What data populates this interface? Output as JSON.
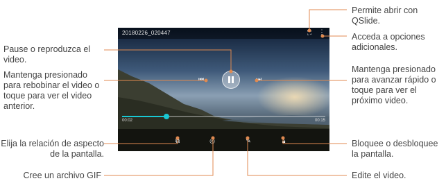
{
  "player": {
    "title": "20180226_020447",
    "progress": 0.22,
    "current_time": "00:02",
    "total_time": "00:15"
  },
  "callouts": {
    "qslide": "Permite abrir con QSlide.",
    "more_options": "Acceda a opciones adicionales.",
    "pause_play": "Pause o reproduzca el video.",
    "rewind": "Mantenga presionado para rebobinar el video o toque para ver el video anterior.",
    "forward": "Mantenga presionado para avanzar rápido o toque para ver el próximo video.",
    "aspect": "Elija la relación de aspecto de la pantalla.",
    "lock": "Bloquee o desbloquee la pantalla.",
    "gif": "Cree un archivo GIF",
    "edit": "Edite el video."
  },
  "colors": {
    "accent": "#19c9d4",
    "leader": "#e08a50"
  },
  "icons": [
    "qslide-icon",
    "more-options-icon",
    "rewind-icon",
    "pause-icon",
    "forward-icon",
    "aspect-ratio-icon",
    "gif-icon",
    "edit-icon",
    "lock-icon"
  ]
}
